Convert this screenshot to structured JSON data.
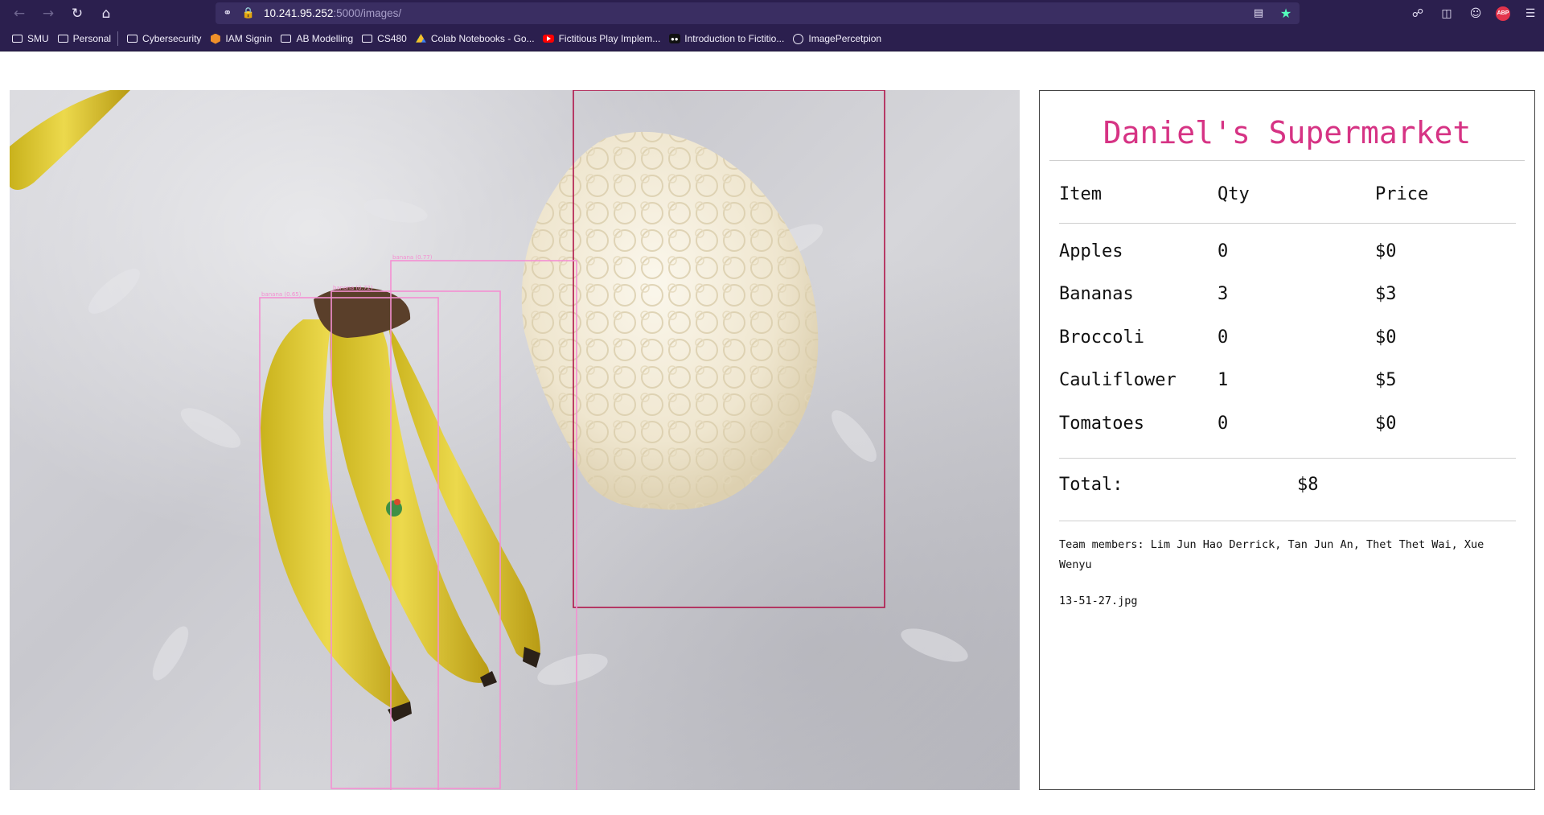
{
  "browser": {
    "url_host": "10.241.95.252",
    "url_path": ":5000/images/",
    "bookmarks": [
      {
        "label": "SMU",
        "icon": "folder-icon"
      },
      {
        "label": "Personal",
        "icon": "folder-icon"
      },
      {
        "label": "Cybersecurity",
        "icon": "folder-icon"
      },
      {
        "label": "IAM Signin",
        "icon": "aws-icon"
      },
      {
        "label": "AB Modelling",
        "icon": "folder-icon"
      },
      {
        "label": "CS480",
        "icon": "folder-icon"
      },
      {
        "label": "Colab Notebooks - Go...",
        "icon": "google-drive-icon"
      },
      {
        "label": "Fictitious Play Implem...",
        "icon": "youtube-icon"
      },
      {
        "label": "Introduction to Fictitio...",
        "icon": "medium-icon"
      },
      {
        "label": "ImagePercetpion",
        "icon": "globe-icon"
      }
    ]
  },
  "photo": {
    "detection_labels": [
      "banana (0.77)",
      "banana (0.72)",
      "banana (0.65)"
    ],
    "box_colors": {
      "banana": "#f48fd2",
      "cauliflower": "#b0154a"
    }
  },
  "receipt": {
    "title": "Daniel's Supermarket",
    "title_color": "#d63384",
    "headers": {
      "item": "Item",
      "qty": "Qty",
      "price": "Price"
    },
    "rows": [
      {
        "item": "Apples",
        "qty": "0",
        "price": "$0"
      },
      {
        "item": "Bananas",
        "qty": "3",
        "price": "$3"
      },
      {
        "item": "Broccoli",
        "qty": "0",
        "price": "$0"
      },
      {
        "item": "Cauliflower",
        "qty": "1",
        "price": "$5"
      },
      {
        "item": "Tomatoes",
        "qty": "0",
        "price": "$0"
      }
    ],
    "total_label": "Total:",
    "total_value": "$8",
    "team": "Team members: Lim Jun Hao Derrick, Tan Jun An, Thet Thet Wai, Xue Wenyu",
    "filename": "13-51-27.jpg"
  }
}
